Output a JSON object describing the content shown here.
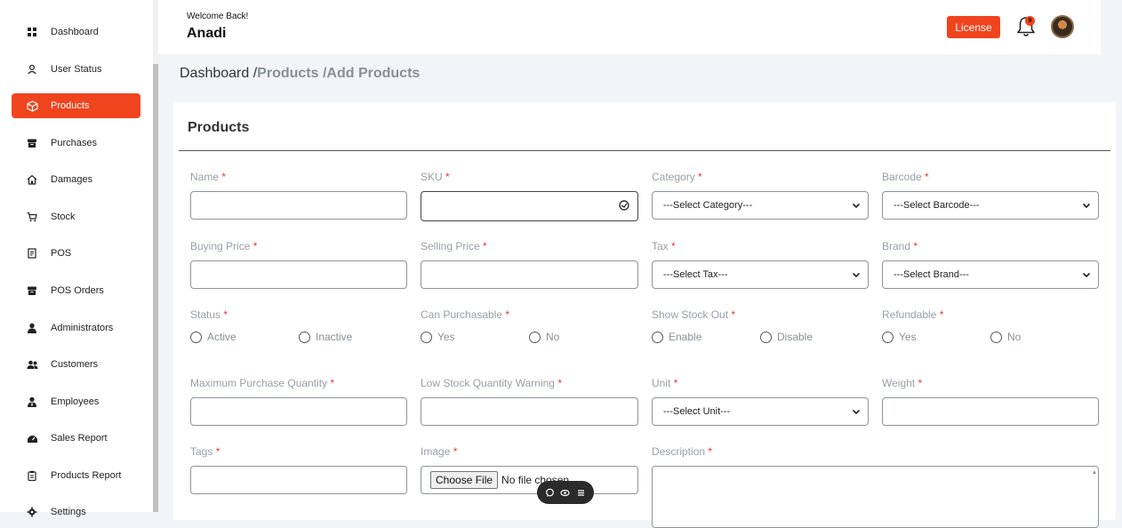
{
  "sidebar": {
    "items": [
      {
        "label": "Dashboard",
        "icon": "grid-icon",
        "active": false
      },
      {
        "label": "User Status",
        "icon": "user-icon",
        "active": false
      },
      {
        "label": "Products",
        "icon": "box-icon",
        "active": true
      },
      {
        "label": "Purchases",
        "icon": "archive-icon",
        "active": false
      },
      {
        "label": "Damages",
        "icon": "home-icon",
        "active": false
      },
      {
        "label": "Stock",
        "icon": "cart-icon",
        "active": false
      },
      {
        "label": "POS",
        "icon": "receipt-icon",
        "active": false
      },
      {
        "label": "POS Orders",
        "icon": "archive-icon",
        "active": false
      },
      {
        "label": "Administrators",
        "icon": "person-icon",
        "active": false
      },
      {
        "label": "Customers",
        "icon": "users-icon",
        "active": false
      },
      {
        "label": "Employees",
        "icon": "person-tie-icon",
        "active": false
      },
      {
        "label": "Sales Report",
        "icon": "chart-icon",
        "active": false
      },
      {
        "label": "Products Report",
        "icon": "clipboard-icon",
        "active": false
      },
      {
        "label": "Settings",
        "icon": "gear-icon",
        "active": false
      }
    ]
  },
  "header": {
    "welcome": "Welcome Back!",
    "username": "Anadi",
    "license_label": "License",
    "notification_count": "9"
  },
  "breadcrumb": {
    "root": "Dashboard /",
    "current": "Products /Add Products"
  },
  "form": {
    "title": "Products",
    "required_mark": "*",
    "name_label": "Name",
    "sku_label": "SKU",
    "category_label": "Category",
    "category_value": "---Select Category---",
    "barcode_label": "Barcode",
    "barcode_value": "---Select Barcode---",
    "buying_price_label": "Buying Price",
    "selling_price_label": "Selling Price",
    "tax_label": "Tax",
    "tax_value": "---Select Tax---",
    "brand_label": "Brand",
    "brand_value": "---Select Brand---",
    "status_label": "Status",
    "status_active": "Active",
    "status_inactive": "Inactive",
    "purchasable_label": "Can Purchasable",
    "purchasable_yes": "Yes",
    "purchasable_no": "No",
    "stock_out_label": "Show Stock Out",
    "stock_out_enable": "Enable",
    "stock_out_disable": "Disable",
    "refundable_label": "Refundable",
    "refundable_yes": "Yes",
    "refundable_no": "No",
    "max_qty_label": "Maximum Purchase Quantity",
    "low_stock_label": "Low Stock Quantity Warning",
    "unit_label": "Unit",
    "unit_value": "---Select Unit---",
    "weight_label": "Weight",
    "tags_label": "Tags",
    "image_label": "Image",
    "choose_file_label": "Choose File",
    "no_file_text": "No file chosen",
    "description_label": "Description"
  },
  "colors": {
    "accent": "#f0441f",
    "required": "#e53935"
  }
}
